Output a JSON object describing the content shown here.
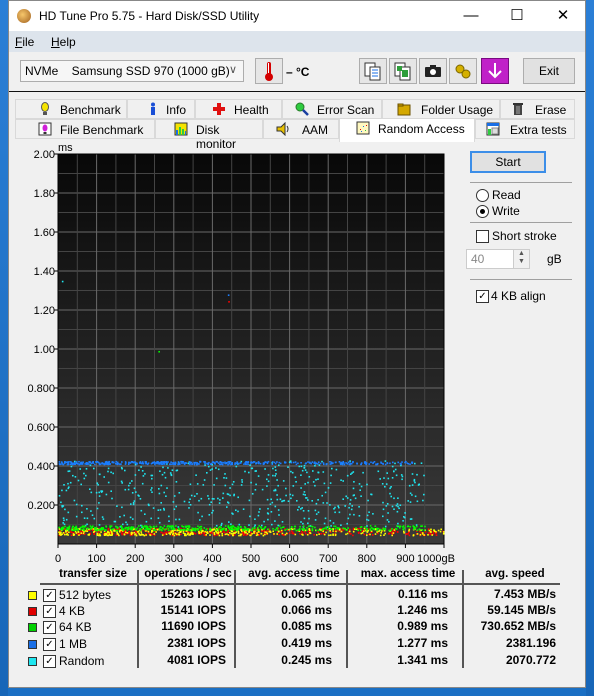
{
  "window": {
    "title": "HD Tune Pro 5.75 - Hard Disk/SSD Utility",
    "controls": {
      "minimize": "—",
      "maximize": "☐",
      "close": "✕"
    }
  },
  "menu": [
    {
      "label": "File",
      "accel": "F",
      "rest": "ile"
    },
    {
      "label": "Help",
      "accel": "H",
      "rest": "elp"
    }
  ],
  "toolbar": {
    "drive": "NVMe    Samsung SSD 970 (1000 gB)",
    "temperature": "– °C",
    "exit_label": "Exit",
    "buttons": [
      "copy-text-icon",
      "copy-screenshot-icon",
      "camera-icon",
      "options-icon",
      "save-down-icon"
    ]
  },
  "tabs": {
    "row1": [
      {
        "label": "Benchmark",
        "icon": "benchmark-icon"
      },
      {
        "label": "Info",
        "icon": "info-icon"
      },
      {
        "label": "Health",
        "icon": "health-icon"
      },
      {
        "label": "Error Scan",
        "icon": "error-scan-icon"
      },
      {
        "label": "Folder Usage",
        "icon": "folder-icon"
      },
      {
        "label": "Erase",
        "icon": "trash-icon"
      }
    ],
    "row2": [
      {
        "label": "File Benchmark",
        "icon": "file-benchmark-icon"
      },
      {
        "label": "Disk monitor",
        "icon": "disk-monitor-icon"
      },
      {
        "label": "AAM",
        "icon": "speaker-icon"
      },
      {
        "label": "Random Access",
        "icon": "random-access-icon",
        "active": true
      },
      {
        "label": "Extra tests",
        "icon": "extra-tests-icon"
      }
    ]
  },
  "side": {
    "start_label": "Start",
    "read_label": "Read",
    "write_label": "Write",
    "mode": "Write",
    "short_stroke_label": "Short stroke",
    "short_stroke_checked": false,
    "short_stroke_value": "40",
    "short_stroke_unit": "gB",
    "align_label": "4 KB align",
    "align_checked": true
  },
  "chart_data": {
    "type": "scatter",
    "title": "",
    "ylabel": "ms",
    "xlabel": "gB",
    "xlim": [
      0,
      1000
    ],
    "ylim": [
      0,
      2.0
    ],
    "x_ticks": [
      "0",
      "100",
      "200",
      "300",
      "400",
      "500",
      "600",
      "700",
      "800",
      "900",
      "1000gB"
    ],
    "y_ticks": [
      "2.00",
      "1.80",
      "1.60",
      "1.40",
      "1.20",
      "1.00",
      "0.800",
      "0.600",
      "0.400",
      "0.200"
    ],
    "grid": true,
    "series": [
      {
        "name": "512 bytes",
        "color": "#ffff00",
        "center_ms": 0.065,
        "spread_ms": 0.03,
        "x_max": 1000
      },
      {
        "name": "4 KB",
        "color": "#ff0000",
        "center_ms": 0.066,
        "spread_ms": 0.03,
        "x_max": 1000
      },
      {
        "name": "64 KB",
        "color": "#00ff00",
        "center_ms": 0.085,
        "spread_ms": 0.02,
        "x_max": 950
      },
      {
        "name": "1 MB",
        "color": "#1a7dff",
        "center_ms": 0.419,
        "spread_ms": 0.015,
        "x_max": 920
      },
      {
        "name": "Random",
        "color": "#1ee6f0",
        "center_ms": 0.245,
        "spread_ms": 0.17,
        "x_max": 950
      }
    ],
    "outliers": [
      {
        "series": "Random",
        "x": 10,
        "y": 1.35
      },
      {
        "series": "1 MB",
        "x": 440,
        "y": 1.28
      },
      {
        "series": "4 KB",
        "x": 441,
        "y": 1.246
      },
      {
        "series": "64 KB",
        "x": 260,
        "y": 0.99
      }
    ]
  },
  "results": {
    "headers": [
      "transfer size",
      "operations / sec",
      "avg. access time",
      "max. access time",
      "avg. speed"
    ],
    "rows": [
      {
        "color": "#ffff00",
        "checked": true,
        "size": "512 bytes",
        "iops": "15263 IOPS",
        "avg": "0.065 ms",
        "max": "0.116 ms",
        "speed": "7.453 MB/s"
      },
      {
        "color": "#e00000",
        "checked": true,
        "size": "4 KB",
        "iops": "15141 IOPS",
        "avg": "0.066 ms",
        "max": "1.246 ms",
        "speed": "59.145 MB/s"
      },
      {
        "color": "#00d000",
        "checked": true,
        "size": "64 KB",
        "iops": "11690 IOPS",
        "avg": "0.085 ms",
        "max": "0.989 ms",
        "speed": "730.652 MB/s"
      },
      {
        "color": "#1a6fe6",
        "checked": true,
        "size": "1 MB",
        "iops": "2381 IOPS",
        "avg": "0.419 ms",
        "max": "1.277 ms",
        "speed": "2381.196"
      },
      {
        "color": "#1ee6f0",
        "checked": true,
        "size": "Random",
        "iops": "4081 IOPS",
        "avg": "0.245 ms",
        "max": "1.341 ms",
        "speed": "2070.772"
      }
    ]
  }
}
